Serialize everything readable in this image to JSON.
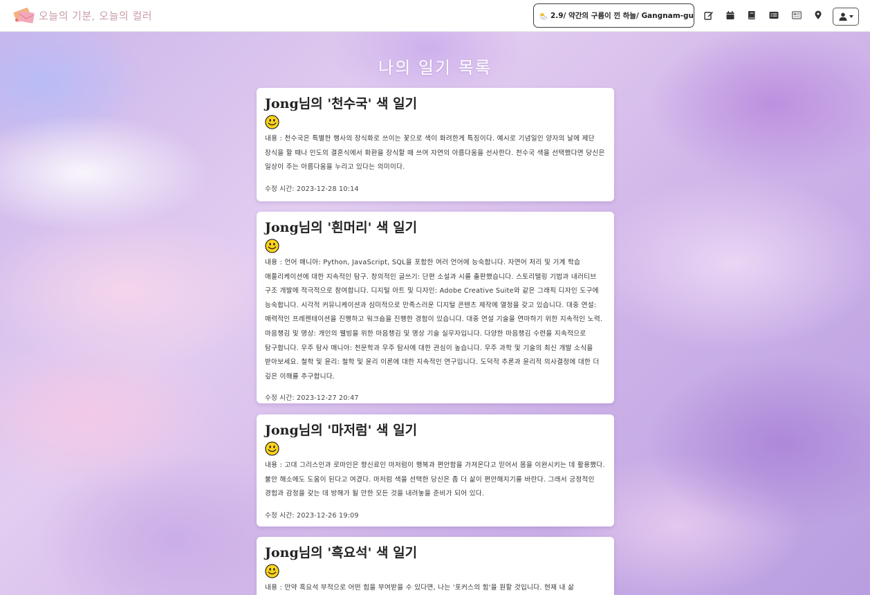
{
  "brand": {
    "name": "오늘의 기분, 오늘의 컬러",
    "logo_icon": "envelope-logo-icon"
  },
  "weather": {
    "text": "2.9/ 약간의 구름이 낀 하늘/ Gangnam-gu",
    "icon": "sun-cloud-icon"
  },
  "nav_icons": [
    "edit-icon",
    "calendar-icon",
    "book-icon",
    "list-card-icon",
    "newspaper-icon",
    "map-pin-icon"
  ],
  "user_menu": {
    "icon": "user-icon"
  },
  "page": {
    "title": "나의 일기 목록"
  },
  "diaries": [
    {
      "title": "Jong님의 '천수국' 색 일기",
      "mood_icon": "smiley-icon",
      "content": "내용 : 천수국은 특별한 행사의 장식화로 쓰이는 꽃으로 색이 화려한게 특징이다. 예시로 기념일인 양자의 날에 제단 장식을 할 때나 인도의 결혼식에서 화환을 장식할 때 쓰여 자연의 아름다움을 선사한다. 천수국 색을 선택했다면 당신은 일상이 주는 아름다움을 누리고 있다는 의미이다.",
      "time": "수정 시간: 2023-12-28 10:14"
    },
    {
      "title": "Jong님의 '흰머리' 색 일기",
      "mood_icon": "smiley-icon",
      "content": "내용 : 언어 매니아: Python, JavaScript, SQL을 포함한 여러 언어에 능숙합니다. 자연어 처리 및 기계 학습 애플리케이션에 대한 지속적인 탐구. 창의적인 글쓰기: 단편 소설과 시를 출판했습니다. 스토리텔링 기법과 내러티브 구조 개발에 적극적으로 참여합니다. 디지털 아트 및 디자인: Adobe Creative Suite와 같은 그래픽 디자인 도구에 능숙합니다. 시각적 커뮤니케이션과 심미적으로 만족스러운 디지털 콘텐츠 제작에 열정을 갖고 있습니다. 대중 연설: 매력적인 프레젠테이션을 진행하고 워크숍을 진행한 경험이 있습니다. 대중 연설 기술을 연마하기 위한 지속적인 노력. 마음챙김 및 명상: 개인의 웰빙을 위한 마음챙김 및 명상 기술 실무자입니다. 다양한 마음챙김 수련을 지속적으로 탐구합니다. 우주 탐사 매니아: 천문학과 우주 탐사에 대한 관심이 높습니다. 우주 과학 및 기술의 최신 개발 소식을 받아보세요. 철학 및 윤리: 철학 및 윤리 이론에 대한 지속적인 연구입니다. 도덕적 추론과 윤리적 의사결정에 대한 더 깊은 이해를 추구합니다.",
      "time": "수정 시간: 2023-12-27 20:47"
    },
    {
      "title": "Jong님의 '마저럼' 색 일기",
      "mood_icon": "smiley-icon",
      "content": "내용 : 고대 그리스인과 로마인은 향신료인 마저럼이 행복과 편안함을 가져온다고 믿어서 몸을 이완시키는 데 활용했다. 불안 해소에도 도움이 된다고 여겼다. 마저럼 색을 선택한 당신은 좀 더 삶이 편안해지기를 바란다. 그래서 긍정적인 경험과 감정을 갖는 데 방해가 될 만한 모든 것을 내려놓을 준비가 되어 있다.",
      "time": "수정 시간: 2023-12-26 19:09"
    },
    {
      "title": "Jong님의 '흑요석' 색 일기",
      "mood_icon": "smiley-icon",
      "content": "내용 : 만약 흑요석 부적으로 어떤 힘을 부여받을 수 있다면, 나는 '포커스의 힘'을 원할 것입니다. 현재 내 삶",
      "time": ""
    }
  ]
}
